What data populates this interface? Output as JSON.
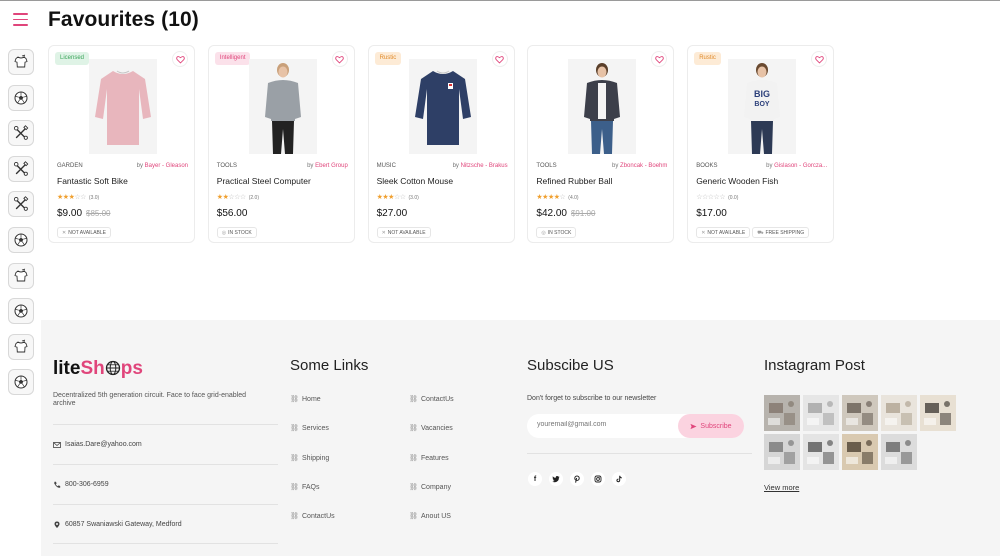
{
  "page": {
    "title": "Favourites (10)"
  },
  "sidebar": {
    "items": [
      {
        "icon": "t-shirt-icon"
      },
      {
        "icon": "soccer-ball-icon"
      },
      {
        "icon": "tools-icon"
      },
      {
        "icon": "tools-icon"
      },
      {
        "icon": "tools-icon"
      },
      {
        "icon": "soccer-ball-icon"
      },
      {
        "icon": "t-shirt-icon"
      },
      {
        "icon": "soccer-ball-icon"
      },
      {
        "icon": "t-shirt-icon"
      },
      {
        "icon": "soccer-ball-icon"
      }
    ]
  },
  "products": [
    {
      "badge": "Licensed",
      "category": "GARDEN",
      "by": "by",
      "brand": "Bayer - Gleason",
      "name": "Fantastic Soft Bike",
      "rating": 3,
      "rating_text": "(3.0)",
      "price": "$9.00",
      "old_price": "$85.00",
      "stock": "NOT AVAILABLE",
      "shipping": ""
    },
    {
      "badge": "Intelligent",
      "category": "TOOLS",
      "by": "by",
      "brand": "Ebert Group",
      "name": "Practical Steel Computer",
      "rating": 2,
      "rating_text": "(2.0)",
      "price": "$56.00",
      "old_price": "",
      "stock": "IN STOCK",
      "shipping": ""
    },
    {
      "badge": "Rustic",
      "category": "MUSIC",
      "by": "by",
      "brand": "Nitzsche - Brakus",
      "name": "Sleek Cotton Mouse",
      "rating": 3,
      "rating_text": "(3.0)",
      "price": "$27.00",
      "old_price": "",
      "stock": "NOT AVAILABLE",
      "shipping": ""
    },
    {
      "badge": "",
      "category": "TOOLS",
      "by": "by",
      "brand": "Zboncak - Boehm",
      "name": "Refined Rubber Ball",
      "rating": 4,
      "rating_text": "(4.0)",
      "price": "$42.00",
      "old_price": "$91.00",
      "stock": "IN STOCK",
      "shipping": ""
    },
    {
      "badge": "Rustic",
      "category": "BOOKS",
      "by": "by",
      "brand": "Gislason - Gorcza...",
      "name": "Generic Wooden Fish",
      "rating": 0,
      "rating_text": "(0.0)",
      "price": "$17.00",
      "old_price": "",
      "stock": "NOT AVAILABLE",
      "shipping": "FREE SHIPPING"
    }
  ],
  "footer": {
    "logo_a": "lite",
    "logo_b": "Sh",
    "logo_c": "ps",
    "tagline": "Decentralized 5th generation circuit. Face to face grid-enabled archive",
    "email": "Isaias.Dare@yahoo.com",
    "phone": "800-306-6959",
    "address": "60857 Swaniawski Gateway, Medford",
    "links_title": "Some Links",
    "links_col1": [
      "Home",
      "Services",
      "Shipping",
      "FAQs",
      "ContactUs"
    ],
    "links_col2": [
      "ContactUs",
      "Vacancies",
      "Features",
      "Company",
      "Anout US"
    ],
    "subscribe_title": "Subscibe US",
    "subscribe_text": "Don't forget to subscribe to our newsletter",
    "email_placeholder": "youremail@gmail.com",
    "subscribe_button": "Subscribe",
    "instagram_title": "Instagram Post",
    "view_more": "View more"
  },
  "colors": {
    "accent": "#e0457b",
    "star": "#f0a030",
    "footer_bg": "#f5f5f5"
  }
}
